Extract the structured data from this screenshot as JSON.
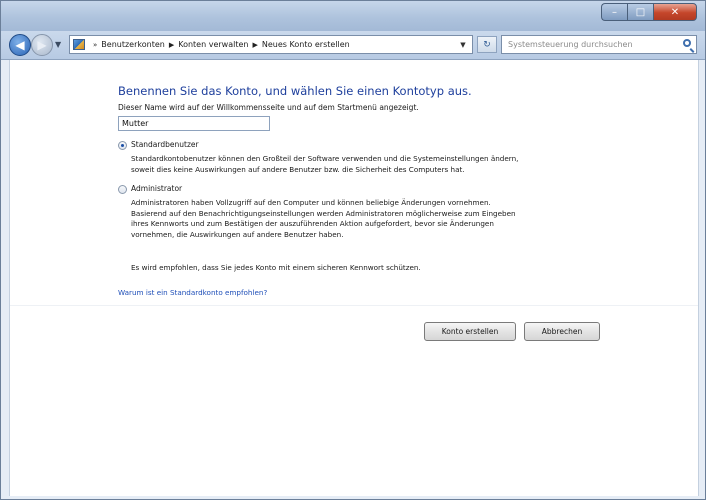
{
  "window": {
    "caption_buttons": {
      "minimize": "–",
      "maximize": "□",
      "close": "✕"
    }
  },
  "navbar": {
    "back_icon": "arrow-left-icon",
    "forward_icon": "arrow-right-icon",
    "breadcrumb": [
      "Benutzerkonten",
      "Konten verwalten",
      "Neues Konto erstellen"
    ],
    "search_placeholder": "Systemsteuerung durchsuchen"
  },
  "main": {
    "heading": "Benennen Sie das Konto, und wählen Sie einen Kontotyp aus.",
    "subtitle": "Dieser Name wird auf der Willkommensseite und auf dem Startmenü angezeigt.",
    "account_name_value": "Mutter",
    "options": [
      {
        "label": "Standardbenutzer",
        "selected": true,
        "description": [
          "Standardkontobenutzer können den Großteil der Software verwenden und die Systemeinstellungen ändern,",
          "soweit dies keine Auswirkungen auf andere Benutzer bzw. die Sicherheit des Computers hat."
        ]
      },
      {
        "label": "Administrator",
        "selected": false,
        "description": [
          "Administratoren haben Vollzugriff auf den Computer und können beliebige Änderungen vornehmen.",
          "Basierend auf den Benachrichtigungseinstellungen werden Administratoren möglicherweise zum Eingeben",
          "ihres Kennworts und zum Bestätigen der auszuführenden Aktion aufgefordert, bevor sie Änderungen",
          "vornehmen, die Auswirkungen auf andere Benutzer haben."
        ]
      }
    ],
    "recommendation": "Es wird empfohlen, dass Sie jedes Konto mit einem sicheren Kennwort schützen.",
    "why_link": "Warum ist ein Standardkonto empfohlen?",
    "create_button": "Konto erstellen",
    "cancel_button": "Abbrechen"
  }
}
